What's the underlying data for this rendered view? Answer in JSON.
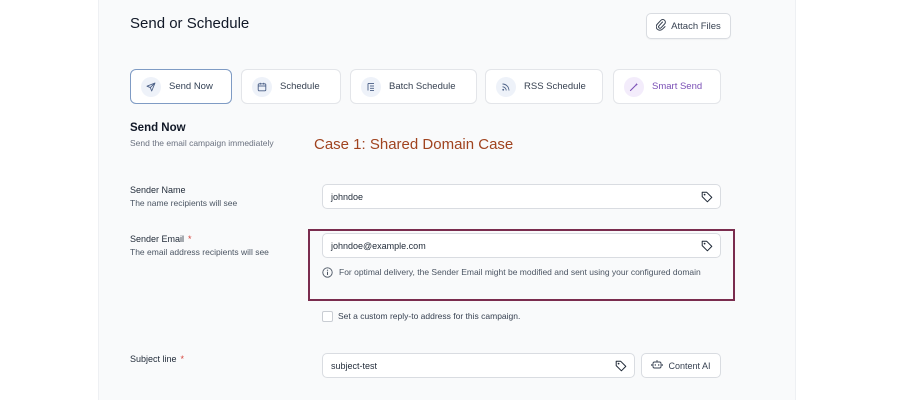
{
  "page": {
    "title": "Send or Schedule"
  },
  "toolbar": {
    "attach_label": "Attach Files",
    "attach_icon": "paperclip-icon"
  },
  "tabs": [
    {
      "label": "Send Now",
      "icon": "send-icon",
      "active": true
    },
    {
      "label": "Schedule",
      "icon": "calendar-icon",
      "active": false
    },
    {
      "label": "Batch Schedule",
      "icon": "batch-list-icon",
      "active": false
    },
    {
      "label": "RSS Schedule",
      "icon": "rss-icon",
      "active": false
    },
    {
      "label": "Smart Send",
      "icon": "magic-wand-icon",
      "active": false
    }
  ],
  "section": {
    "title": "Send Now",
    "description": "Send the email campaign immediately"
  },
  "annotation": "Case 1: Shared Domain Case",
  "fields": {
    "sender_name": {
      "label": "Sender Name",
      "hint": "The name recipients will see",
      "value": "johndoe"
    },
    "sender_email": {
      "label": "Sender Email",
      "required_mark": "*",
      "hint": "The email address recipients will see",
      "value": "johndoe@example.com",
      "info": "For optimal delivery, the Sender Email might be modified and sent using your configured domain"
    },
    "reply_to": {
      "label": "Set a custom reply-to address for this campaign.",
      "checked": false
    },
    "subject": {
      "label": "Subject line",
      "required_mark": "*",
      "value": "subject-test",
      "ai_button": "Content AI"
    }
  },
  "colors": {
    "accent": "#7f9bc4",
    "annotation": "#a0431f",
    "highlight_box": "#7a2c4e",
    "required": "#d6453d",
    "smart_send": "#7a4fb5"
  }
}
